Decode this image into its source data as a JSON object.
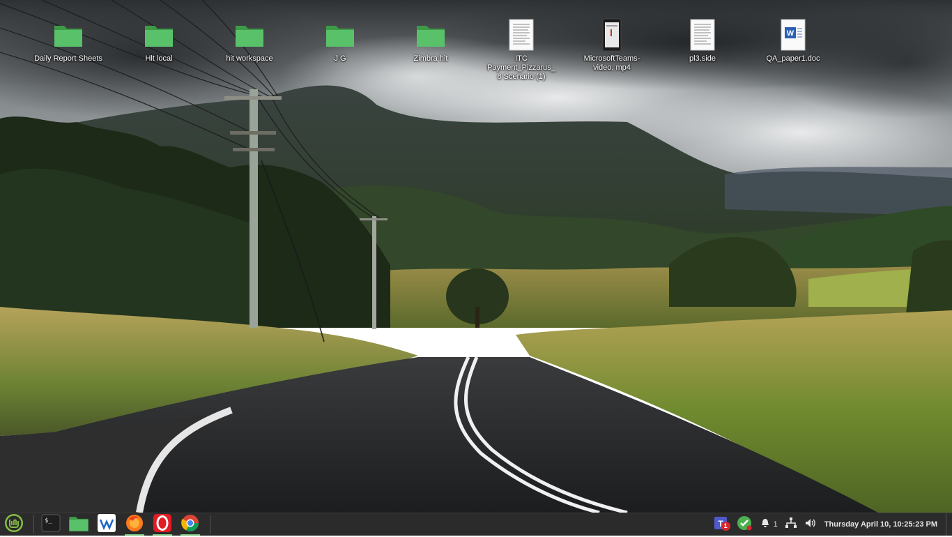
{
  "desktop": {
    "icons": [
      {
        "name": "folder-daily-report-sheets",
        "type": "folder",
        "label": "Daily Report Sheets"
      },
      {
        "name": "folder-hlt-local",
        "type": "folder",
        "label": "Hlt local"
      },
      {
        "name": "folder-hit-workspace",
        "type": "folder",
        "label": "hit workspace"
      },
      {
        "name": "folder-jg",
        "type": "folder",
        "label": "J G"
      },
      {
        "name": "folder-zimbra-hit",
        "type": "folder",
        "label": "Zimbra hit"
      },
      {
        "name": "file-itc-payment",
        "type": "document",
        "label": "ITC Payment_Pizzarus_ 8 Scenario (1)"
      },
      {
        "name": "file-teams-video",
        "type": "video",
        "label": "MicrosoftTeams-video. mp4"
      },
      {
        "name": "file-pl3-side",
        "type": "document",
        "label": "pl3.side"
      },
      {
        "name": "file-qa-paper",
        "type": "word",
        "label": "QA_paper1.doc"
      }
    ]
  },
  "taskbar": {
    "launchers": [
      {
        "name": "menu-button",
        "icon": "linux-mint-logo-icon"
      },
      {
        "name": "terminal-launcher",
        "icon": "terminal-icon"
      },
      {
        "name": "files-launcher",
        "icon": "folder-icon"
      },
      {
        "name": "remote-launcher",
        "icon": "remote-desktop-icon"
      },
      {
        "name": "firefox-launcher",
        "icon": "firefox-icon"
      },
      {
        "name": "opera-launcher",
        "icon": "opera-icon"
      },
      {
        "name": "chrome-launcher",
        "icon": "chrome-icon"
      }
    ],
    "tray": {
      "teams_badge": "1",
      "notifications_count": "1",
      "clock": "Thursday April 10, 10:25:23 PM"
    }
  },
  "colors": {
    "taskbar_bg": "#2b2b2b",
    "folder_green": "#4cb050",
    "active_indicator": "#7bc47f"
  }
}
